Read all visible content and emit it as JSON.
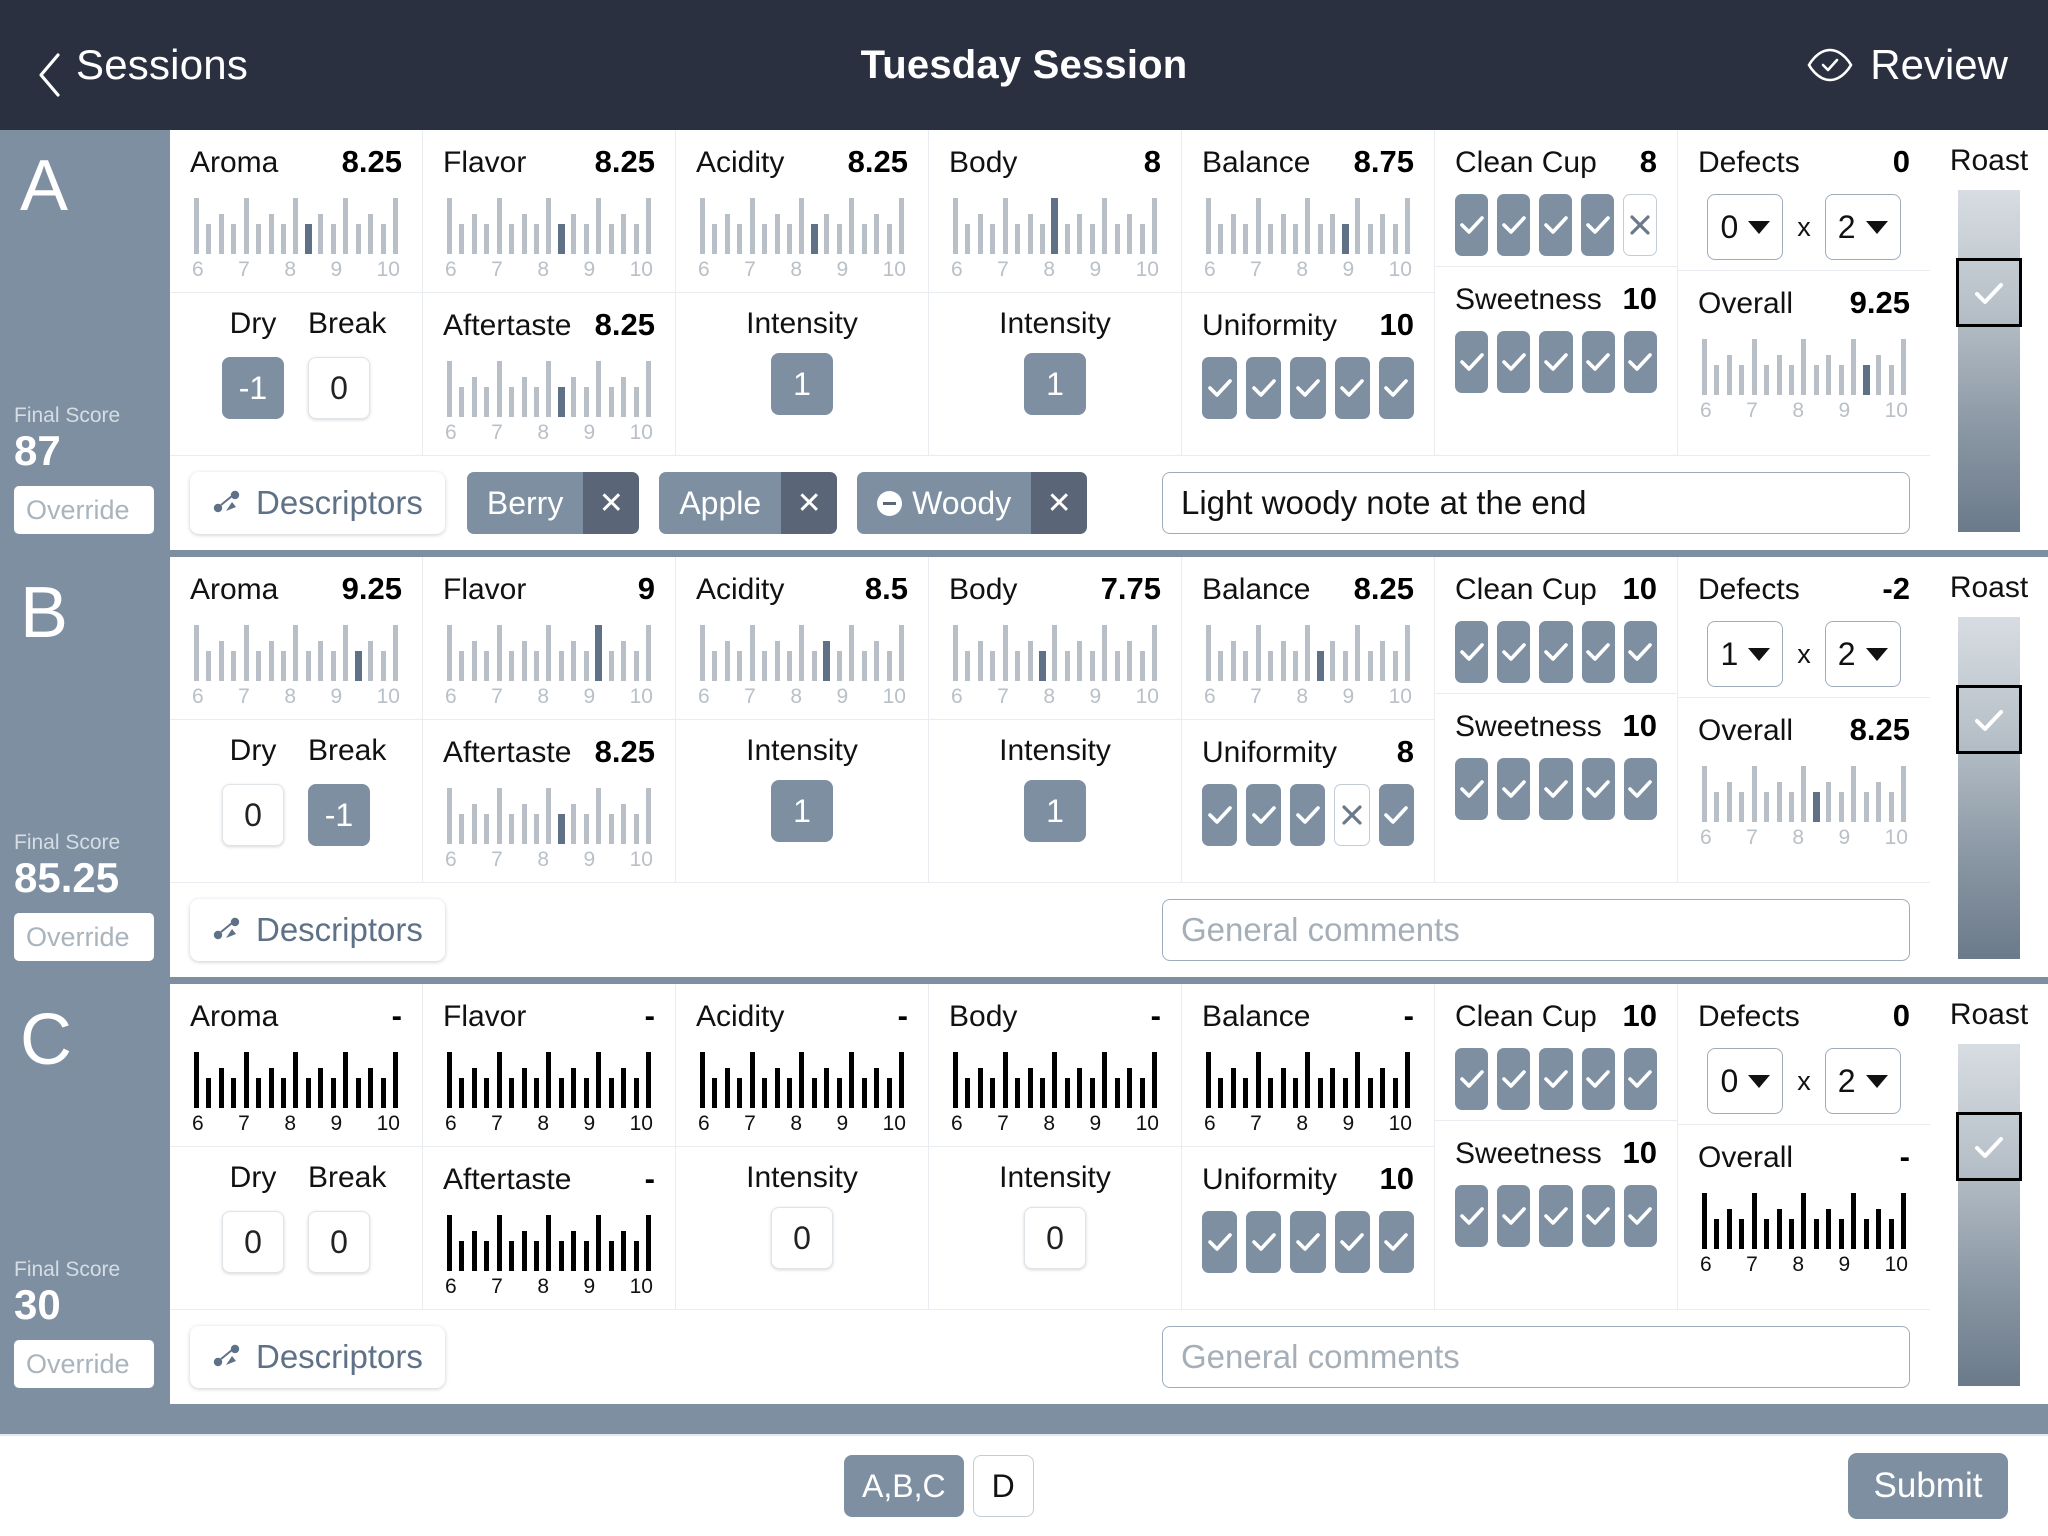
{
  "header": {
    "back_label": "Sessions",
    "back_icon": "chevron-left-icon",
    "title": "Tuesday Session",
    "review_label": "Review",
    "review_icon": "eye-check-icon"
  },
  "axis_labels": [
    "6",
    "7",
    "8",
    "9",
    "10"
  ],
  "labels": {
    "aroma": "Aroma",
    "flavor": "Flavor",
    "acidity": "Acidity",
    "body": "Body",
    "balance": "Balance",
    "clean_cup": "Clean Cup",
    "defects": "Defects",
    "dry": "Dry",
    "break": "Break",
    "aftertaste": "Aftertaste",
    "intensity": "Intensity",
    "uniformity": "Uniformity",
    "sweetness": "Sweetness",
    "overall": "Overall",
    "roast": "Roast",
    "final_score": "Final Score",
    "override_placeholder": "Override",
    "descriptors": "Descriptors",
    "comments_placeholder": "General comments",
    "defect_multiply": "x"
  },
  "samples": [
    {
      "letter": "A",
      "final_score": "87",
      "override": "",
      "aroma": {
        "value": "8.25",
        "num": 8.25
      },
      "flavor": {
        "value": "8.25",
        "num": 8.25
      },
      "acidity": {
        "value": "8.25",
        "num": 8.25
      },
      "body": {
        "value": "8",
        "num": 8
      },
      "balance": {
        "value": "8.75",
        "num": 8.75
      },
      "aftertaste": {
        "value": "8.25",
        "num": 8.25
      },
      "overall": {
        "value": "9.25",
        "num": 9.25
      },
      "dry": {
        "value": "-1",
        "active": true
      },
      "break": {
        "value": "0",
        "active": false
      },
      "acidity_intensity": {
        "value": "1",
        "active": true
      },
      "body_intensity": {
        "value": "1",
        "active": true
      },
      "clean_cup": {
        "value": "8",
        "checks": [
          true,
          true,
          true,
          true,
          false
        ]
      },
      "uniformity": {
        "value": "10",
        "checks": [
          true,
          true,
          true,
          true,
          true
        ]
      },
      "sweetness": {
        "value": "10",
        "checks": [
          true,
          true,
          true,
          true,
          true
        ]
      },
      "defects": {
        "value": "0",
        "count": "0",
        "intensity": "2"
      },
      "roast": {
        "position": 1
      },
      "descriptors": [
        {
          "label": "Berry",
          "negative": false
        },
        {
          "label": "Apple",
          "negative": false
        },
        {
          "label": "Woody",
          "negative": true
        }
      ],
      "comment": "Light woody note at the end",
      "comment_is_placeholder": false
    },
    {
      "letter": "B",
      "final_score": "85.25",
      "override": "",
      "aroma": {
        "value": "9.25",
        "num": 9.25
      },
      "flavor": {
        "value": "9",
        "num": 9
      },
      "acidity": {
        "value": "8.5",
        "num": 8.5
      },
      "body": {
        "value": "7.75",
        "num": 7.75
      },
      "balance": {
        "value": "8.25",
        "num": 8.25
      },
      "aftertaste": {
        "value": "8.25",
        "num": 8.25
      },
      "overall": {
        "value": "8.25",
        "num": 8.25
      },
      "dry": {
        "value": "0",
        "active": false
      },
      "break": {
        "value": "-1",
        "active": true
      },
      "acidity_intensity": {
        "value": "1",
        "active": true
      },
      "body_intensity": {
        "value": "1",
        "active": true
      },
      "clean_cup": {
        "value": "10",
        "checks": [
          true,
          true,
          true,
          true,
          true
        ]
      },
      "uniformity": {
        "value": "8",
        "checks": [
          true,
          true,
          true,
          false,
          true
        ]
      },
      "sweetness": {
        "value": "10",
        "checks": [
          true,
          true,
          true,
          true,
          true
        ]
      },
      "defects": {
        "value": "-2",
        "count": "1",
        "intensity": "2"
      },
      "roast": {
        "position": 1
      },
      "descriptors": [],
      "comment": "General comments",
      "comment_is_placeholder": true
    },
    {
      "letter": "C",
      "final_score": "30",
      "override": "",
      "aroma": {
        "value": "-",
        "num": null
      },
      "flavor": {
        "value": "-",
        "num": null
      },
      "acidity": {
        "value": "-",
        "num": null
      },
      "body": {
        "value": "-",
        "num": null
      },
      "balance": {
        "value": "-",
        "num": null
      },
      "aftertaste": {
        "value": "-",
        "num": null
      },
      "overall": {
        "value": "-",
        "num": null
      },
      "dry": {
        "value": "0",
        "active": false
      },
      "break": {
        "value": "0",
        "active": false
      },
      "acidity_intensity": {
        "value": "0",
        "active": false
      },
      "body_intensity": {
        "value": "0",
        "active": false
      },
      "clean_cup": {
        "value": "10",
        "checks": [
          true,
          true,
          true,
          true,
          true
        ]
      },
      "uniformity": {
        "value": "10",
        "checks": [
          true,
          true,
          true,
          true,
          true
        ]
      },
      "sweetness": {
        "value": "10",
        "checks": [
          true,
          true,
          true,
          true,
          true
        ]
      },
      "defects": {
        "value": "0",
        "count": "0",
        "intensity": "2"
      },
      "roast": {
        "position": 1
      },
      "descriptors": [],
      "comment": "General comments",
      "comment_is_placeholder": true
    }
  ],
  "footer": {
    "segments": [
      {
        "label": "A,B,C",
        "active": true
      },
      {
        "label": "D",
        "active": false
      }
    ],
    "submit_label": "Submit"
  }
}
